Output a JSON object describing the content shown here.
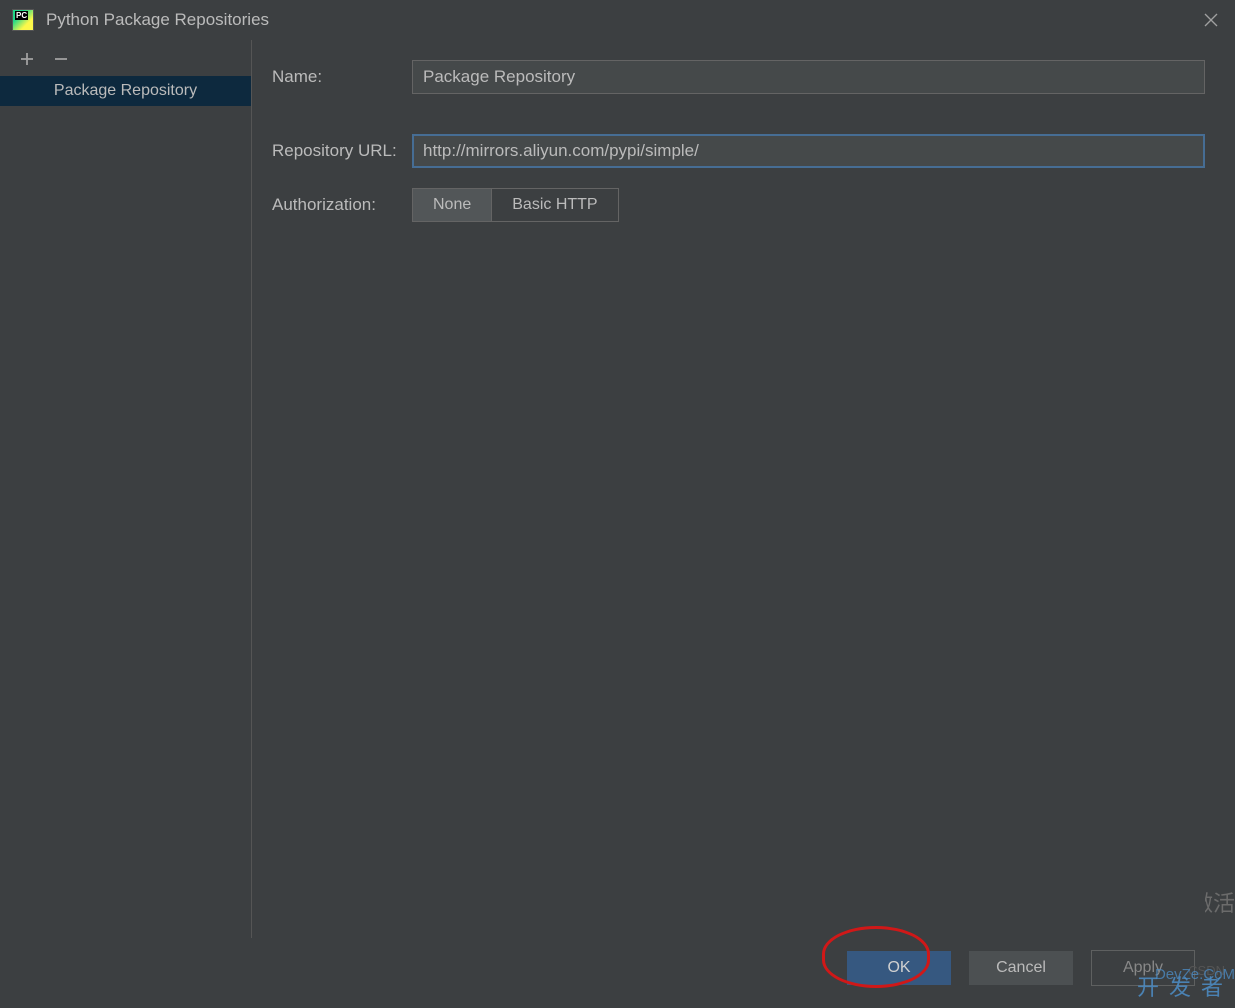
{
  "window": {
    "title": "Python Package Repositories",
    "icon_label": "PC"
  },
  "sidebar": {
    "items": [
      {
        "label": "Package Repository",
        "selected": true
      }
    ]
  },
  "form": {
    "name_label": "Name:",
    "name_value": "Package Repository",
    "url_label": "Repository URL:",
    "url_value": "http://mirrors.aliyun.com/pypi/simple/",
    "auth_label": "Authorization:",
    "auth_options": {
      "none": "None",
      "basic": "Basic HTTP"
    },
    "auth_selected": "None"
  },
  "footer": {
    "ok": "OK",
    "cancel": "Cancel",
    "apply": "Apply"
  },
  "watermarks": {
    "csdn": "CSDN",
    "devze": "DevZe.CoM",
    "kaifazhe": "开发者",
    "activate": "激活"
  }
}
